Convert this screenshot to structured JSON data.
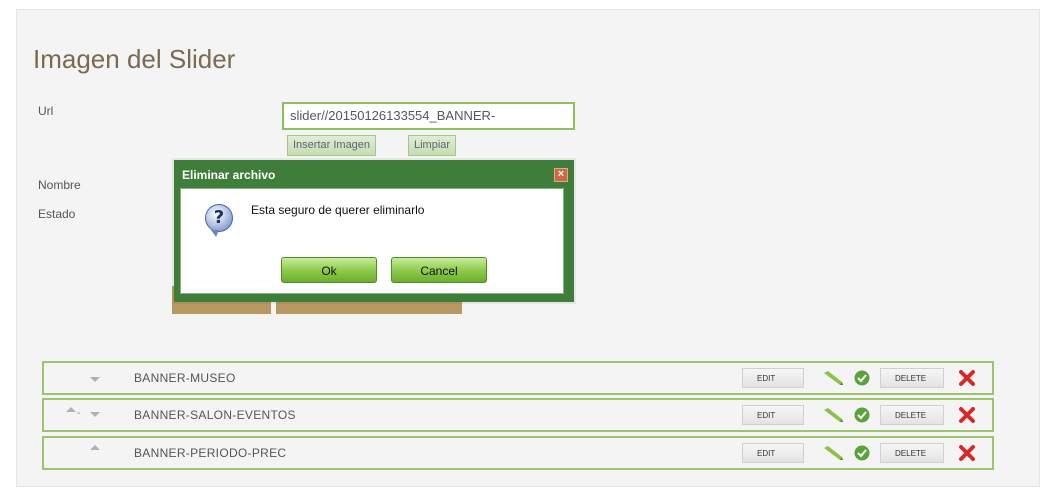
{
  "page": {
    "title": "Imagen del Slider"
  },
  "form": {
    "url_label": "Url",
    "url_value": "slider//20150126133554_BANNER-",
    "insert_image_label": "Insertar Imagen",
    "clear_label": "Limpiar",
    "name_label": "Nombre",
    "status_label": "Estado"
  },
  "dialog": {
    "title": "Eliminar archivo",
    "close_glyph": "×",
    "icon_glyph": "?",
    "message": "Esta seguro de querer eliminarlo",
    "ok_label": "Ok",
    "cancel_label": "Cancel"
  },
  "list": {
    "items": [
      {
        "label": "BANNER-MUSEO",
        "up": false,
        "down": true,
        "edit_label": "EDIT",
        "delete_label": "DELETE"
      },
      {
        "label": "BANNER-SALON-EVENTOS",
        "up": true,
        "down": true,
        "separator": "-",
        "edit_label": "EDIT",
        "delete_label": "DELETE"
      },
      {
        "label": "BANNER-PERIODO-PREC",
        "up": true,
        "down": false,
        "edit_label": "EDIT",
        "delete_label": "DELETE"
      }
    ]
  },
  "colors": {
    "accent_green": "#9bc46c",
    "dialog_green": "#3f7d3a",
    "title_brown": "#7a6a52",
    "delete_red": "#d42a2a",
    "check_green": "#5aa33a"
  },
  "icons": [
    "question-icon",
    "close-icon",
    "arrow-up-icon",
    "arrow-down-icon",
    "pencil-icon",
    "check-icon",
    "delete-x-icon"
  ]
}
